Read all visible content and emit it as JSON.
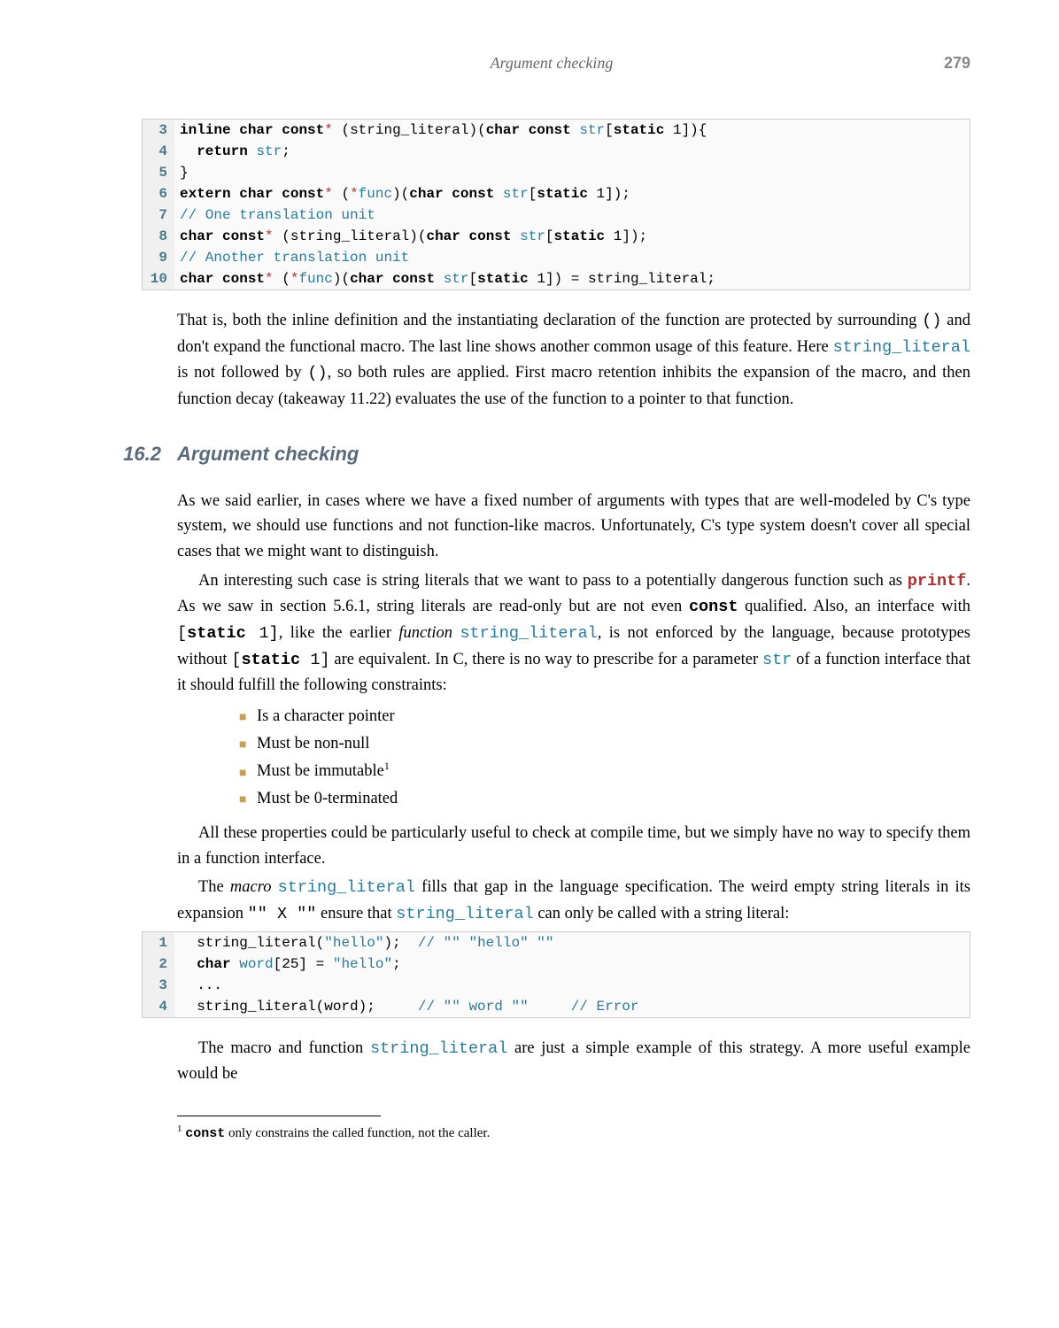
{
  "header": {
    "title": "Argument checking",
    "page": "279"
  },
  "code1": {
    "start": 3,
    "lines": [
      [
        [
          "kw",
          "inline"
        ],
        [
          "plain",
          " "
        ],
        [
          "kw",
          "char"
        ],
        [
          "plain",
          " "
        ],
        [
          "kw",
          "const"
        ],
        [
          "op",
          "*"
        ],
        [
          "plain",
          " (string_literal)("
        ],
        [
          "kw",
          "char"
        ],
        [
          "plain",
          " "
        ],
        [
          "kw",
          "const"
        ],
        [
          "plain",
          " "
        ],
        [
          "id",
          "str"
        ],
        [
          "plain",
          "["
        ],
        [
          "kw",
          "static"
        ],
        [
          "plain",
          " 1]){"
        ]
      ],
      [
        [
          "plain",
          "  "
        ],
        [
          "kw",
          "return"
        ],
        [
          "plain",
          " "
        ],
        [
          "id",
          "str"
        ],
        [
          "plain",
          ";"
        ]
      ],
      [
        [
          "plain",
          "}"
        ]
      ],
      [
        [
          "kw",
          "extern"
        ],
        [
          "plain",
          " "
        ],
        [
          "kw",
          "char"
        ],
        [
          "plain",
          " "
        ],
        [
          "kw",
          "const"
        ],
        [
          "op",
          "*"
        ],
        [
          "plain",
          " ("
        ],
        [
          "op",
          "*"
        ],
        [
          "id",
          "func"
        ],
        [
          "plain",
          ")("
        ],
        [
          "kw",
          "char"
        ],
        [
          "plain",
          " "
        ],
        [
          "kw",
          "const"
        ],
        [
          "plain",
          " "
        ],
        [
          "id",
          "str"
        ],
        [
          "plain",
          "["
        ],
        [
          "kw",
          "static"
        ],
        [
          "plain",
          " 1]);"
        ]
      ],
      [
        [
          "cmt",
          "// One translation unit"
        ]
      ],
      [
        [
          "kw",
          "char"
        ],
        [
          "plain",
          " "
        ],
        [
          "kw",
          "const"
        ],
        [
          "op",
          "*"
        ],
        [
          "plain",
          " (string_literal)("
        ],
        [
          "kw",
          "char"
        ],
        [
          "plain",
          " "
        ],
        [
          "kw",
          "const"
        ],
        [
          "plain",
          " "
        ],
        [
          "id",
          "str"
        ],
        [
          "plain",
          "["
        ],
        [
          "kw",
          "static"
        ],
        [
          "plain",
          " 1]);"
        ]
      ],
      [
        [
          "cmt",
          "// Another translation unit"
        ]
      ],
      [
        [
          "kw",
          "char"
        ],
        [
          "plain",
          " "
        ],
        [
          "kw",
          "const"
        ],
        [
          "op",
          "*"
        ],
        [
          "plain",
          " ("
        ],
        [
          "op",
          "*"
        ],
        [
          "id",
          "func"
        ],
        [
          "plain",
          ")("
        ],
        [
          "kw",
          "char"
        ],
        [
          "plain",
          " "
        ],
        [
          "kw",
          "const"
        ],
        [
          "plain",
          " "
        ],
        [
          "id",
          "str"
        ],
        [
          "plain",
          "["
        ],
        [
          "kw",
          "static"
        ],
        [
          "plain",
          " 1]) = string_literal;"
        ]
      ]
    ]
  },
  "para1": [
    "That is, both the inline definition and the instantiating declaration of the function are protected by surrounding ",
    [
      "code",
      "()"
    ],
    " and don't expand the functional macro. The last line shows another common usage of this feature. Here ",
    [
      "id",
      "string_literal"
    ],
    " is not followed by ",
    [
      "code",
      "()"
    ],
    ", so both rules are applied. First macro retention inhibits the expansion of the macro, and then function decay (takeaway 11.22) evaluates the use of the function to a pointer to that function."
  ],
  "section": {
    "num": "16.2",
    "title": "Argument checking"
  },
  "para2": [
    " As we said earlier, in cases where we have a fixed number of arguments with types that are well-modeled by C's type system, we should use functions and not function-like macros. Unfortunately, C's type system doesn't cover all special cases that we might want to distinguish."
  ],
  "para3": [
    "An interesting such case is string literals that we want to pass to a potentially dangerous function such as ",
    [
      "fn",
      "printf"
    ],
    ". As we saw in section 5.6.1, string literals are read-only but are not even ",
    [
      "kwb",
      "const"
    ],
    " qualified. Also, an interface with ",
    [
      "code",
      "["
    ],
    [
      "kwb",
      "static"
    ],
    [
      "code",
      " 1]"
    ],
    ", like the earlier ",
    [
      "i",
      "function"
    ],
    " ",
    [
      "id",
      "string_literal"
    ],
    ", is not enforced by the language, because prototypes without ",
    [
      "code",
      "["
    ],
    [
      "kwb",
      "static"
    ],
    [
      "code",
      " 1]"
    ],
    " are equivalent. In C, there is no way to prescribe for a parameter ",
    [
      "id",
      "str"
    ],
    " of a function interface that it should fulfill the following constraints:"
  ],
  "bullets": [
    "Is a character pointer",
    "Must be non-null",
    "Must be immutable¹",
    "Must be 0-terminated"
  ],
  "para4": [
    "All these properties could be particularly useful to check at compile time, but we simply have no way to specify them in a function interface."
  ],
  "para5": [
    "The ",
    [
      "i",
      "macro"
    ],
    " ",
    [
      "id",
      "string_literal"
    ],
    " fills that gap in the language specification. The weird empty string literals in its expansion ",
    [
      "code",
      "\"\" X \"\""
    ],
    " ensure that ",
    [
      "id",
      "string_literal"
    ],
    " can only be called with a string literal:"
  ],
  "code2": {
    "start": 1,
    "lines": [
      [
        [
          "plain",
          "  string_literal("
        ],
        [
          "str",
          "\"hello\""
        ],
        [
          "plain",
          ");  "
        ],
        [
          "cmt",
          "// \"\" \"hello\" \"\""
        ]
      ],
      [
        [
          "plain",
          "  "
        ],
        [
          "kw",
          "char"
        ],
        [
          "plain",
          " "
        ],
        [
          "id",
          "word"
        ],
        [
          "plain",
          "[25] = "
        ],
        [
          "str",
          "\"hello\""
        ],
        [
          "plain",
          ";"
        ]
      ],
      [
        [
          "plain",
          "  ..."
        ]
      ],
      [
        [
          "plain",
          "  string_literal(word);     "
        ],
        [
          "cmt",
          "// \"\" word \"\""
        ],
        [
          "plain",
          "     "
        ],
        [
          "cmt",
          "// Error"
        ]
      ]
    ]
  },
  "para6": [
    "The macro and function ",
    [
      "id",
      "string_literal"
    ],
    " are just a simple example of this strategy. A more useful example would be"
  ],
  "footnote": {
    "num": "1",
    "body": [
      [
        "kwb",
        "const"
      ],
      " only constrains the called function, not the caller."
    ]
  }
}
